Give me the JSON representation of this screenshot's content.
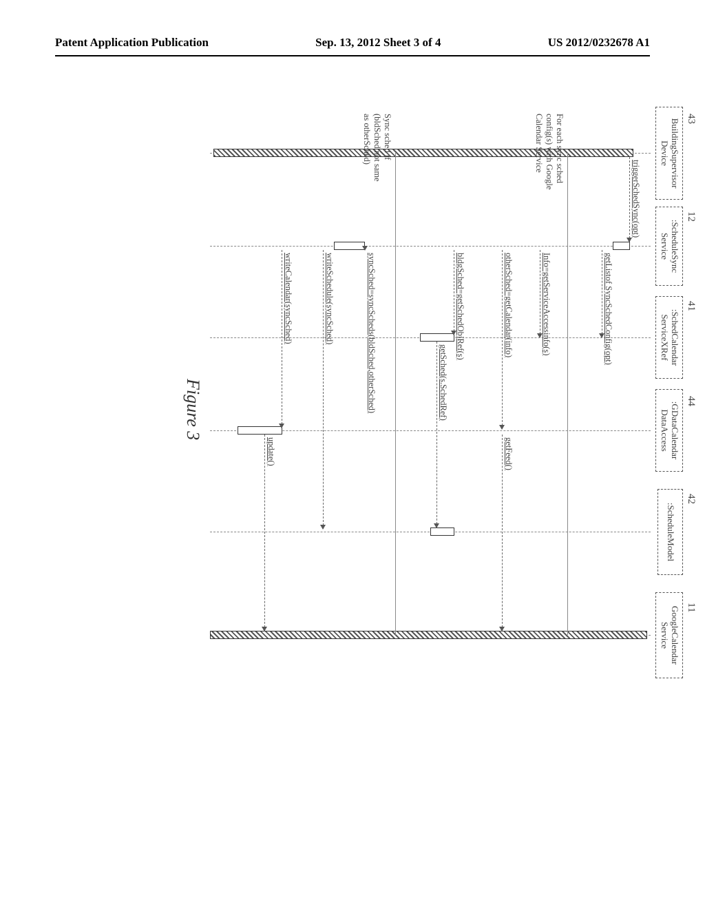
{
  "header": {
    "left": "Patent Application Publication",
    "center": "Sep. 13, 2012  Sheet 3 of 4",
    "right": "US 2012/0232678 A1"
  },
  "lifelines": {
    "l43": {
      "ref": "43",
      "name1": "BuildingSupervisor",
      "name2": "Device"
    },
    "l12": {
      "ref": "12",
      "name1": ":ScheduleSync",
      "name2": "Service"
    },
    "l41": {
      "ref": "41",
      "name1": ":SchedCalendar",
      "name2": "ServiceXRef"
    },
    "l44": {
      "ref": "44",
      "name1": ":GDataCalendar",
      "name2": "DataAccess"
    },
    "l42": {
      "ref": "42",
      "name1": ":ScheduleModel",
      "name2": ""
    },
    "l11": {
      "ref": "11",
      "name1": "GoogleCalendar",
      "name2": "Service"
    }
  },
  "messages": {
    "m1": "triggerSchedSync(opt)",
    "m2": "getListof SyncSchedConfig(opt)",
    "m3": "Info=getServiceAccessinfo(s)",
    "m4": "otherSched=getCalendar(info)",
    "m5": "getFeed()",
    "m6": "bldgSched=getSchedObjRef(s)",
    "m7": "getSched(s.SchedRef)",
    "m8": "syncSched=syncScheds(bldSched,otherSched)",
    "m9": "writeSchedule(syncSched)",
    "m10": "writeCalendar(syncSched)",
    "m11": "update()"
  },
  "notes": {
    "n1a": "For each sync sched",
    "n1b": "config(s) with Google",
    "n1c": "Calendar Service",
    "n2a": "Sync sched if",
    "n2b": "(bldSched not same",
    "n2c": "as otherSched)"
  },
  "caption": "Figure 3"
}
